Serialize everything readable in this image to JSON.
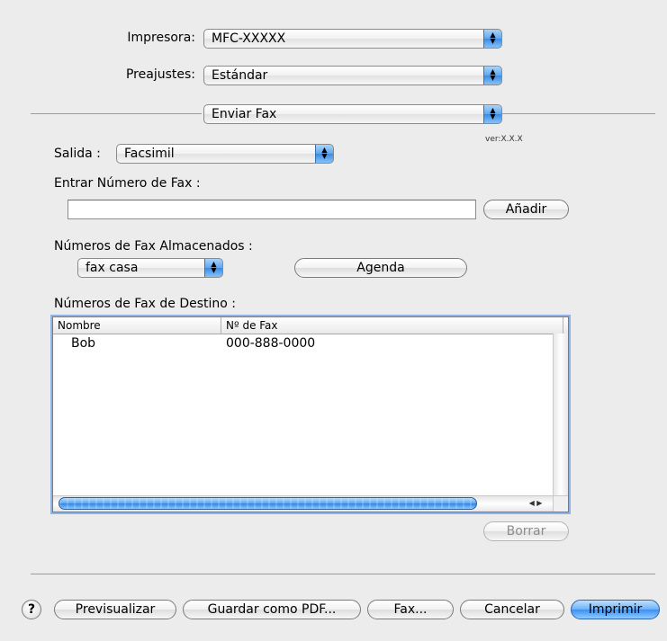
{
  "printer": {
    "label": "Impresora:",
    "value": "MFC-XXXXX"
  },
  "presets": {
    "label": "Preajustes:",
    "value": "Estándar"
  },
  "panel": {
    "value": "Enviar Fax"
  },
  "version": "ver:X.X.X",
  "output": {
    "label": "Salida :",
    "value": "Facsimil"
  },
  "fax_number": {
    "label": "Entrar Número de Fax :",
    "value": "",
    "add_button": "Añadir"
  },
  "stored": {
    "label": "Números de Fax Almacenados :",
    "value": "fax casa",
    "agenda_button": "Agenda"
  },
  "destination": {
    "label": "Números de Fax de Destino :",
    "columns": [
      "Nombre",
      "Nº de Fax"
    ],
    "rows": [
      {
        "name": "Bob",
        "fax": "000-888-0000"
      }
    ],
    "delete_button": "Borrar"
  },
  "footer": {
    "help": "?",
    "preview": "Previsualizar",
    "save_pdf": "Guardar como PDF...",
    "fax": "Fax...",
    "cancel": "Cancelar",
    "print": "Imprimir"
  }
}
